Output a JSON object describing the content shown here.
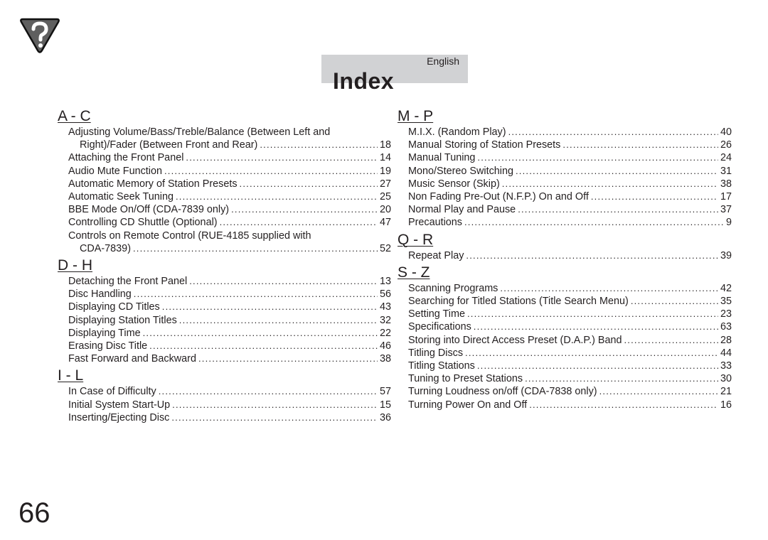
{
  "header": {
    "icon": "help-question-icon",
    "language": "English",
    "title": "Index"
  },
  "left_column": [
    {
      "heading": "A - C",
      "entries": [
        {
          "lines": [
            "Adjusting Volume/Bass/Treble/Balance (Between Left and",
            "Right)/Fader (Between Front and Rear)"
          ],
          "page": "18"
        },
        {
          "lines": [
            "Attaching the Front Panel"
          ],
          "page": "14"
        },
        {
          "lines": [
            "Audio Mute Function"
          ],
          "page": "19"
        },
        {
          "lines": [
            "Automatic Memory of Station Presets"
          ],
          "page": "27"
        },
        {
          "lines": [
            "Automatic Seek Tuning"
          ],
          "page": "25"
        },
        {
          "lines": [
            "BBE Mode On/Off (CDA-7839 only)"
          ],
          "page": "20"
        },
        {
          "lines": [
            "Controlling CD Shuttle (Optional)"
          ],
          "page": "47"
        },
        {
          "lines": [
            "Controls on Remote Control (RUE-4185 supplied with",
            "CDA-7839)"
          ],
          "page": "52"
        }
      ]
    },
    {
      "heading": "D - H",
      "entries": [
        {
          "lines": [
            "Detaching the Front Panel"
          ],
          "page": "13"
        },
        {
          "lines": [
            "Disc Handling"
          ],
          "page": "56"
        },
        {
          "lines": [
            "Displaying CD Titles"
          ],
          "page": "43"
        },
        {
          "lines": [
            "Displaying Station Titles"
          ],
          "page": "32"
        },
        {
          "lines": [
            "Displaying Time"
          ],
          "page": "22"
        },
        {
          "lines": [
            "Erasing Disc Title"
          ],
          "page": "46"
        },
        {
          "lines": [
            "Fast Forward and Backward"
          ],
          "page": "38"
        }
      ]
    },
    {
      "heading": "I - L",
      "entries": [
        {
          "lines": [
            "In Case of Difficulty"
          ],
          "page": "57"
        },
        {
          "lines": [
            "Initial System Start-Up"
          ],
          "page": "15"
        },
        {
          "lines": [
            "Inserting/Ejecting Disc"
          ],
          "page": "36"
        }
      ]
    }
  ],
  "right_column": [
    {
      "heading": "M - P",
      "entries": [
        {
          "lines": [
            "M.I.X. (Random Play)"
          ],
          "page": "40"
        },
        {
          "lines": [
            "Manual Storing of Station Presets"
          ],
          "page": "26"
        },
        {
          "lines": [
            "Manual Tuning"
          ],
          "page": "24"
        },
        {
          "lines": [
            "Mono/Stereo Switching"
          ],
          "page": "31"
        },
        {
          "lines": [
            "Music Sensor (Skip)"
          ],
          "page": "38"
        },
        {
          "lines": [
            "Non Fading Pre-Out (N.F.P.) On and Off"
          ],
          "page": "17"
        },
        {
          "lines": [
            "Normal Play and Pause"
          ],
          "page": "37"
        },
        {
          "lines": [
            "Precautions"
          ],
          "page": "9"
        }
      ]
    },
    {
      "heading": "Q - R",
      "entries": [
        {
          "lines": [
            "Repeat Play"
          ],
          "page": "39"
        }
      ]
    },
    {
      "heading": "S - Z",
      "entries": [
        {
          "lines": [
            "Scanning Programs"
          ],
          "page": "42"
        },
        {
          "lines": [
            "Searching for Titled Stations (Title Search Menu)"
          ],
          "page": "35"
        },
        {
          "lines": [
            "Setting Time"
          ],
          "page": "23"
        },
        {
          "lines": [
            "Specifications"
          ],
          "page": "63"
        },
        {
          "lines": [
            "Storing into Direct Access Preset (D.A.P.) Band"
          ],
          "page": "28"
        },
        {
          "lines": [
            "Titling Discs"
          ],
          "page": "44"
        },
        {
          "lines": [
            "Titling Stations"
          ],
          "page": "33"
        },
        {
          "lines": [
            "Tuning to Preset Stations"
          ],
          "page": "30"
        },
        {
          "lines": [
            "Turning Loudness on/off (CDA-7838 only)"
          ],
          "page": "21"
        },
        {
          "lines": [
            "Turning Power On and Off"
          ],
          "page": "16"
        }
      ]
    }
  ],
  "footer": {
    "page_number": "66"
  },
  "colors": {
    "text": "#231f20",
    "header_band": "#d1d2d4",
    "icon_fill": "#5f5f5f"
  }
}
